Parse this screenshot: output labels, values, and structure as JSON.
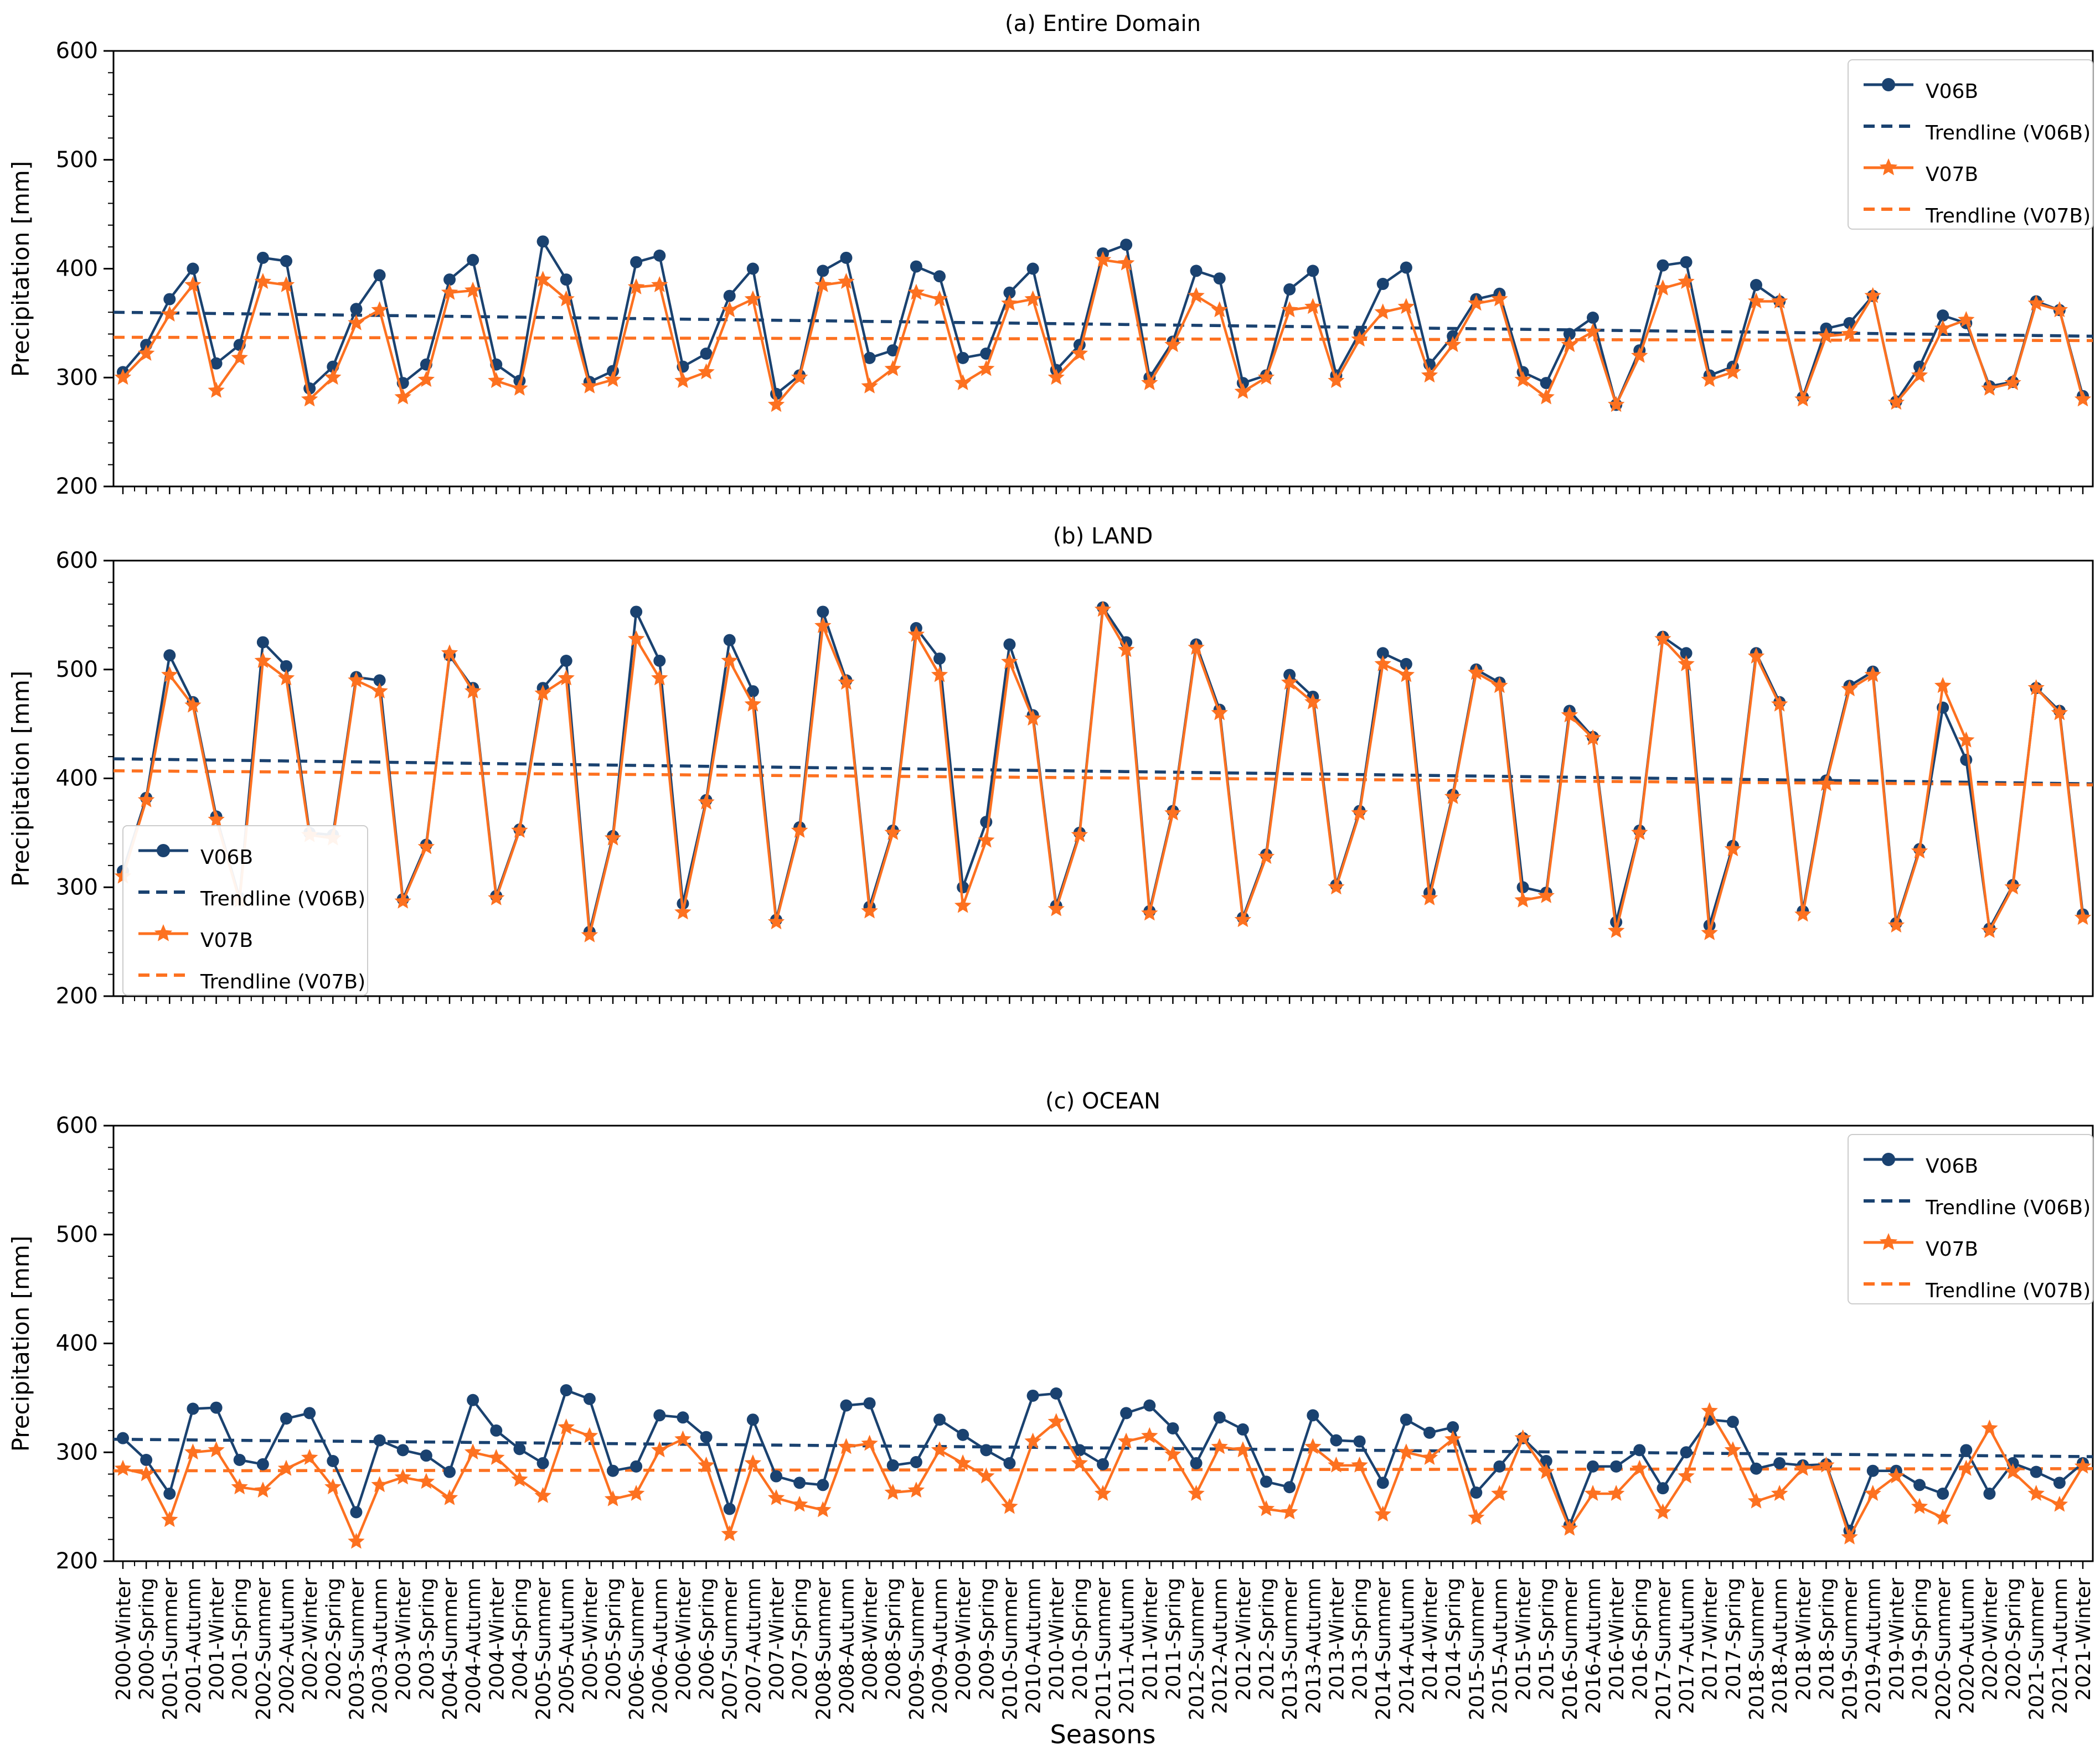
{
  "xlabel": "Seasons",
  "ylabel": "Precipitation [mm]",
  "colors": {
    "v06b": "#1a4270",
    "v07b": "#fd7120",
    "spine": "#000000",
    "legend_border": "#cccccc"
  },
  "legend_labels": {
    "v06b": "V06B",
    "trend_v06b": "Trendline (V06B)",
    "v07b": "V07B",
    "trend_v07b": "Trendline (V07B)"
  },
  "seasons": [
    "2000-Winter",
    "2000-Spring",
    "2001-Summer",
    "2001-Autumn",
    "2001-Winter",
    "2001-Spring",
    "2002-Summer",
    "2002-Autumn",
    "2002-Winter",
    "2002-Spring",
    "2003-Summer",
    "2003-Autumn",
    "2003-Winter",
    "2003-Spring",
    "2004-Summer",
    "2004-Autumn",
    "2004-Winter",
    "2004-Spring",
    "2005-Summer",
    "2005-Autumn",
    "2005-Winter",
    "2005-Spring",
    "2006-Summer",
    "2006-Autumn",
    "2006-Winter",
    "2006-Spring",
    "2007-Summer",
    "2007-Autumn",
    "2007-Winter",
    "2007-Spring",
    "2008-Summer",
    "2008-Autumn",
    "2008-Winter",
    "2008-Spring",
    "2009-Summer",
    "2009-Autumn",
    "2009-Winter",
    "2009-Spring",
    "2010-Summer",
    "2010-Autumn",
    "2010-Winter",
    "2010-Spring",
    "2011-Summer",
    "2011-Autumn",
    "2011-Winter",
    "2011-Spring",
    "2012-Summer",
    "2012-Autumn",
    "2012-Winter",
    "2012-Spring",
    "2013-Summer",
    "2013-Autumn",
    "2013-Winter",
    "2013-Spring",
    "2014-Summer",
    "2014-Autumn",
    "2014-Winter",
    "2014-Spring",
    "2015-Summer",
    "2015-Autumn",
    "2015-Winter",
    "2015-Spring",
    "2016-Summer",
    "2016-Autumn",
    "2016-Winter",
    "2016-Spring",
    "2017-Summer",
    "2017-Autumn",
    "2017-Winter",
    "2017-Spring",
    "2018-Summer",
    "2018-Autumn",
    "2018-Winter",
    "2018-Spring",
    "2019-Summer",
    "2019-Autumn",
    "2019-Winter",
    "2019-Spring",
    "2020-Summer",
    "2020-Autumn",
    "2020-Winter",
    "2020-Spring",
    "2021-Summer",
    "2021-Autumn",
    "2021-Winter"
  ],
  "chart_data": [
    {
      "type": "line",
      "title": "(a) Entire Domain",
      "ylabel": "Precipitation [mm]",
      "ylim": [
        200,
        600
      ],
      "yticks": [
        200,
        300,
        400,
        500,
        600
      ],
      "grid": false,
      "legend_position": "top-right",
      "series": [
        {
          "name": "V06B",
          "marker": "circle",
          "color": "#1a4270",
          "values": [
            305,
            330,
            372,
            400,
            313,
            330,
            410,
            407,
            290,
            310,
            363,
            394,
            295,
            312,
            390,
            408,
            312,
            297,
            425,
            390,
            296,
            306,
            406,
            412,
            310,
            322,
            375,
            400,
            285,
            302,
            398,
            410,
            318,
            325,
            402,
            393,
            318,
            322,
            378,
            400,
            307,
            330,
            414,
            422,
            300,
            333,
            398,
            391,
            295,
            302,
            381,
            398,
            302,
            341,
            386,
            401,
            312,
            338,
            372,
            377,
            305,
            295,
            340,
            355,
            275,
            325,
            403,
            406,
            302,
            310,
            385,
            370,
            282,
            345,
            350,
            375,
            278,
            310,
            357,
            350,
            292,
            296,
            370,
            362,
            283
          ]
        },
        {
          "name": "V07B",
          "marker": "star",
          "color": "#fd7120",
          "values": [
            300,
            322,
            358,
            385,
            288,
            318,
            388,
            385,
            280,
            300,
            350,
            362,
            282,
            298,
            378,
            380,
            297,
            290,
            390,
            372,
            292,
            298,
            383,
            385,
            297,
            305,
            362,
            372,
            275,
            300,
            385,
            388,
            292,
            308,
            378,
            372,
            295,
            308,
            368,
            372,
            300,
            322,
            408,
            405,
            295,
            330,
            375,
            362,
            287,
            300,
            362,
            365,
            297,
            335,
            360,
            365,
            302,
            330,
            368,
            372,
            298,
            282,
            330,
            342,
            275,
            320,
            382,
            388,
            298,
            305,
            370,
            370,
            280,
            338,
            340,
            375,
            277,
            302,
            345,
            353,
            290,
            295,
            368,
            362,
            280
          ]
        }
      ],
      "trendlines": [
        {
          "name": "Trendline (V06B)",
          "color": "#1a4270",
          "start": 360,
          "end": 338
        },
        {
          "name": "Trendline (V07B)",
          "color": "#fd7120",
          "start": 337,
          "end": 334
        }
      ]
    },
    {
      "type": "line",
      "title": "(b) LAND",
      "ylabel": "Precipitation [mm]",
      "ylim": [
        200,
        600
      ],
      "yticks": [
        200,
        300,
        400,
        500,
        600
      ],
      "grid": false,
      "legend_position": "bottom-left",
      "series": [
        {
          "name": "V06B",
          "marker": "circle",
          "color": "#1a4270",
          "values": [
            315,
            382,
            513,
            470,
            365,
            290,
            525,
            503,
            350,
            348,
            493,
            490,
            289,
            339,
            513,
            483,
            292,
            353,
            483,
            508,
            259,
            347,
            553,
            508,
            285,
            380,
            527,
            480,
            270,
            355,
            553,
            490,
            282,
            352,
            538,
            510,
            300,
            360,
            523,
            458,
            283,
            350,
            557,
            525,
            278,
            370,
            523,
            463,
            272,
            330,
            495,
            475,
            302,
            370,
            515,
            505,
            295,
            385,
            500,
            488,
            300,
            295,
            462,
            438,
            268,
            352,
            530,
            515,
            265,
            338,
            515,
            470,
            278,
            398,
            485,
            498,
            267,
            335,
            465,
            417,
            262,
            302,
            483,
            462,
            275
          ]
        },
        {
          "name": "V07B",
          "marker": "star",
          "color": "#fd7120",
          "values": [
            310,
            380,
            495,
            467,
            362,
            288,
            508,
            492,
            348,
            345,
            490,
            480,
            287,
            337,
            515,
            480,
            290,
            352,
            478,
            492,
            256,
            345,
            528,
            492,
            277,
            378,
            508,
            468,
            268,
            352,
            540,
            488,
            278,
            350,
            532,
            495,
            283,
            343,
            507,
            455,
            280,
            348,
            555,
            518,
            276,
            368,
            520,
            460,
            270,
            328,
            488,
            470,
            300,
            368,
            505,
            495,
            290,
            383,
            497,
            485,
            288,
            292,
            458,
            437,
            260,
            350,
            528,
            505,
            258,
            335,
            512,
            468,
            275,
            395,
            482,
            495,
            265,
            333,
            485,
            435,
            260,
            300,
            483,
            460,
            272
          ]
        }
      ],
      "trendlines": [
        {
          "name": "Trendline (V06B)",
          "color": "#1a4270",
          "start": 418,
          "end": 395
        },
        {
          "name": "Trendline (V07B)",
          "color": "#fd7120",
          "start": 407,
          "end": 394
        }
      ]
    },
    {
      "type": "line",
      "title": "(c) OCEAN",
      "ylabel": "Precipitation [mm]",
      "ylim": [
        200,
        600
      ],
      "yticks": [
        200,
        300,
        400,
        500,
        600
      ],
      "grid": false,
      "legend_position": "top-right",
      "series": [
        {
          "name": "V06B",
          "marker": "circle",
          "color": "#1a4270",
          "values": [
            313,
            293,
            262,
            340,
            341,
            293,
            289,
            331,
            336,
            292,
            245,
            311,
            302,
            297,
            282,
            348,
            320,
            303,
            290,
            357,
            349,
            283,
            287,
            334,
            332,
            314,
            248,
            330,
            278,
            272,
            270,
            343,
            345,
            288,
            291,
            330,
            316,
            302,
            290,
            352,
            354,
            302,
            289,
            336,
            343,
            322,
            290,
            332,
            321,
            273,
            268,
            334,
            311,
            310,
            272,
            330,
            318,
            323,
            263,
            287,
            313,
            292,
            233,
            287,
            287,
            302,
            267,
            300,
            330,
            328,
            285,
            290,
            288,
            289,
            228,
            283,
            283,
            270,
            262,
            302,
            262,
            290,
            282,
            272,
            290
          ]
        },
        {
          "name": "V07B",
          "marker": "star",
          "color": "#fd7120",
          "values": [
            285,
            280,
            238,
            300,
            302,
            268,
            265,
            285,
            295,
            268,
            218,
            270,
            277,
            273,
            258,
            300,
            295,
            275,
            260,
            323,
            315,
            257,
            262,
            302,
            312,
            288,
            225,
            290,
            258,
            252,
            247,
            305,
            308,
            263,
            265,
            302,
            290,
            278,
            250,
            310,
            328,
            290,
            262,
            310,
            315,
            298,
            262,
            305,
            302,
            248,
            245,
            305,
            288,
            288,
            243,
            300,
            295,
            312,
            240,
            262,
            313,
            282,
            230,
            262,
            262,
            285,
            245,
            278,
            338,
            302,
            255,
            262,
            285,
            288,
            222,
            262,
            278,
            250,
            240,
            285,
            322,
            282,
            262,
            252,
            287
          ]
        }
      ],
      "trendlines": [
        {
          "name": "Trendline (V06B)",
          "color": "#1a4270",
          "start": 312,
          "end": 296
        },
        {
          "name": "Trendline (V07B)",
          "color": "#fd7120",
          "start": 283,
          "end": 285
        }
      ]
    }
  ]
}
